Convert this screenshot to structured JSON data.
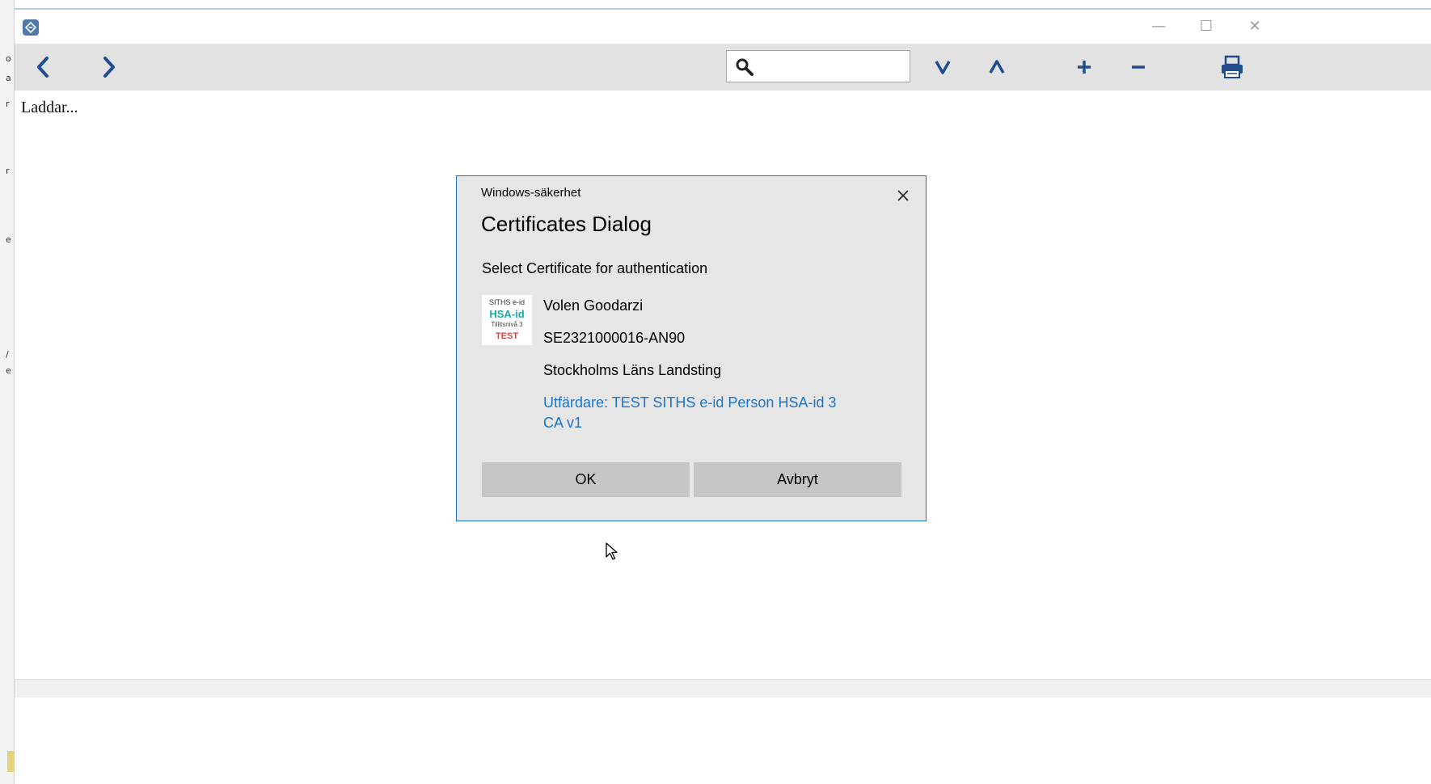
{
  "window": {
    "minimize_glyph": "—",
    "maximize_glyph": "☐",
    "close_glyph": "✕"
  },
  "toolbar": {
    "search_placeholder": "",
    "search_value": "",
    "find_next_label": "V",
    "find_prev_label": "Λ",
    "zoom_in_label": "+",
    "zoom_out_label": "−"
  },
  "content": {
    "status_text": "Laddar..."
  },
  "dialog": {
    "subtitle": "Windows-säkerhet",
    "title": "Certificates Dialog",
    "prompt": "Select Certificate for authentication",
    "certificate": {
      "logo": {
        "line1": "SITHS e-id",
        "line2": "HSA-id",
        "line3": "Tillitsnivå 3",
        "line4": "TEST"
      },
      "name": "Volen Goodarzi",
      "id": "SE2321000016-AN90",
      "organization": "Stockholms Läns Landsting",
      "issuer": "Utfärdare: TEST SITHS e-id Person HSA-id 3 CA v1"
    },
    "ok_label": "OK",
    "cancel_label": "Avbryt"
  },
  "colors": {
    "toolbar_icon": "#1f4d8f",
    "dialog_border": "#1a73c8",
    "issuer_link": "#1b76c8",
    "button_bg": "#c6c6c6"
  }
}
